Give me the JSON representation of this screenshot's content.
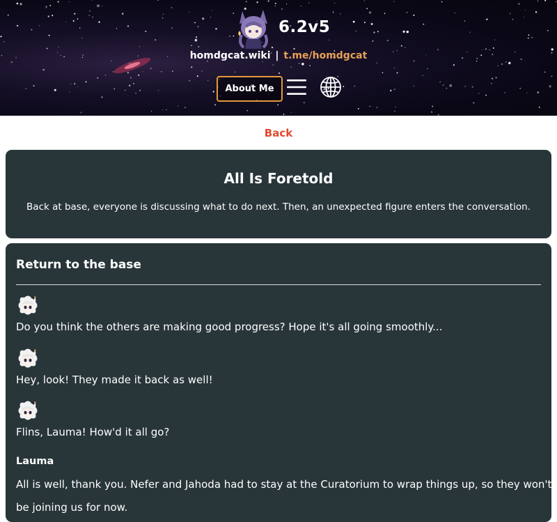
{
  "header": {
    "version": "6.2v5",
    "site_link": "homdgcat.wiki",
    "separator": "|",
    "telegram_link": "t.me/homdgcat",
    "about_button": "About Me",
    "icons": {
      "avatar": "mascot-avatar-icon",
      "menu": "hamburger-menu-icon",
      "language": "globe-icon"
    },
    "colors": {
      "accent": "#e6a155",
      "button_border": "#e39a3a"
    }
  },
  "nav": {
    "back_label": "Back",
    "back_color": "#e04a2f"
  },
  "chapter": {
    "title": "All Is Foretold",
    "description": "Back at base, everyone is discussing what to do next. Then, an unexpected figure enters the conversation."
  },
  "section": {
    "title": "Return to the base",
    "lines": [
      {
        "speaker_icon": "paimon-icon",
        "text": "Do you think the others are making good progress? Hope it's all going smoothly..."
      },
      {
        "speaker_icon": "paimon-icon",
        "text": "Hey, look! They made it back as well!"
      },
      {
        "speaker_icon": "paimon-icon",
        "text": "Flins, Lauma! How'd it all go?"
      },
      {
        "speaker": "Lauma",
        "text": "All is well, thank you. Nefer and Jahoda had to stay at the Curatorium to wrap things up, so they won't",
        "text_cont": "be joining us for now."
      }
    ]
  },
  "colors": {
    "card_bg": "#283539",
    "page_bg": "#ffffff"
  }
}
